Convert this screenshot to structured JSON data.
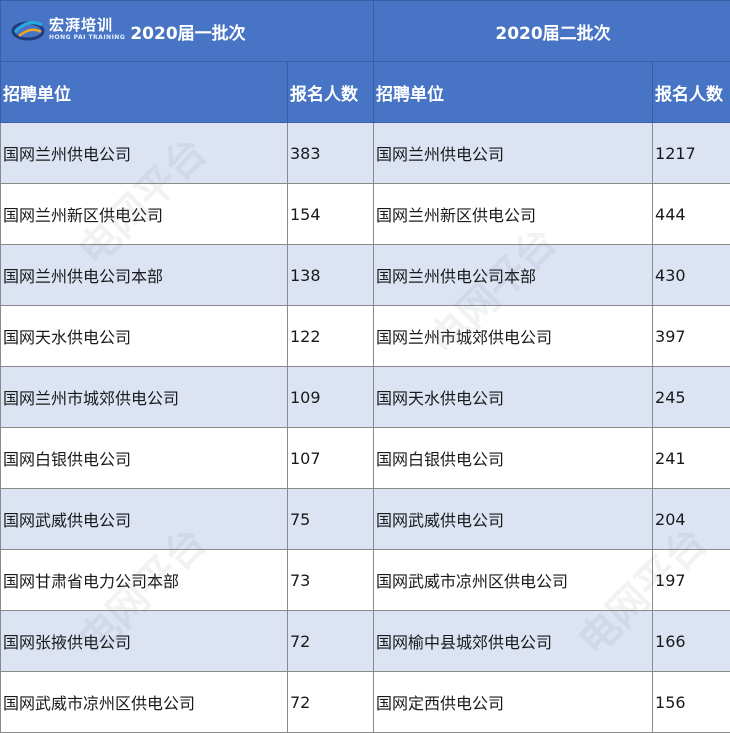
{
  "logo": {
    "name_cn": "宏湃培训",
    "name_en": "HONG PAI TRAINING"
  },
  "batches": [
    {
      "title": "2020届一批次"
    },
    {
      "title": "2020届二批次"
    }
  ],
  "columns": {
    "unit": "招聘单位",
    "count": "报名人数"
  },
  "rows": [
    {
      "u1": "国网兰州供电公司",
      "c1": "383",
      "u2": "国网兰州供电公司",
      "c2": "1217"
    },
    {
      "u1": "国网兰州新区供电公司",
      "c1": "154",
      "u2": "国网兰州新区供电公司",
      "c2": "444"
    },
    {
      "u1": "国网兰州供电公司本部",
      "c1": "138",
      "u2": "国网兰州供电公司本部",
      "c2": "430"
    },
    {
      "u1": "国网天水供电公司",
      "c1": "122",
      "u2": "国网兰州市城郊供电公司",
      "c2": "397"
    },
    {
      "u1": "国网兰州市城郊供电公司",
      "c1": "109",
      "u2": "国网天水供电公司",
      "c2": "245"
    },
    {
      "u1": "国网白银供电公司",
      "c1": "107",
      "u2": "国网白银供电公司",
      "c2": "241"
    },
    {
      "u1": "国网武威供电公司",
      "c1": "75",
      "u2": "国网武威供电公司",
      "c2": "204"
    },
    {
      "u1": "国网甘肃省电力公司本部",
      "c1": "73",
      "u2": "国网武威市凉州区供电公司",
      "c2": "197"
    },
    {
      "u1": "国网张掖供电公司",
      "c1": "72",
      "u2": "国网榆中县城郊供电公司",
      "c2": "166"
    },
    {
      "u1": "国网武威市凉州区供电公司",
      "c1": "72",
      "u2": "国网定西供电公司",
      "c2": "156"
    }
  ],
  "watermark": "电网平台"
}
